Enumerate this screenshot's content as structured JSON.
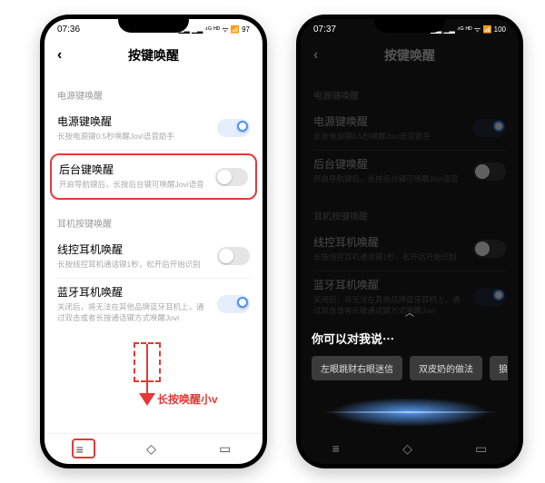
{
  "left": {
    "time": "07:36",
    "status_icons": "▁▂ ▁▂ ⁴ᴳ ᴴᴰ ᯤ 📶 97",
    "header_title": "按键唤醒",
    "section1_title": "电源键唤醒",
    "row_power": {
      "title": "电源键唤醒",
      "sub": "长按电源键0.5秒唤醒Jovi语音助手"
    },
    "row_back": {
      "title": "后台键唤醒",
      "sub": "开启导航键后，长按后台键可唤醒Jovi语音"
    },
    "section2_title": "耳机按键唤醒",
    "row_wired": {
      "title": "线控耳机唤醒",
      "sub": "长按线控耳机通话键1秒，松开后开始识别"
    },
    "row_bt": {
      "title": "蓝牙耳机唤醒",
      "sub": "关闭后，将无法在其他品牌蓝牙耳机上，通过双击或者长按通话键方式唤醒Jovi"
    },
    "annotation_label": "长按唤醒小v"
  },
  "right": {
    "time": "07:37",
    "status_icons": "▁▂ ▁▂ ⁴ᴳ ᴴᴰ ᯤ 📶 100",
    "header_title": "按键唤醒",
    "section1_title": "电源键唤醒",
    "row_power": {
      "title": "电源键唤醒",
      "sub": "长按电源键0.5秒唤醒Jovi语音助手"
    },
    "row_back": {
      "title": "后台键唤醒",
      "sub": "开启导航键后，长按后台键可唤醒Jovi语音"
    },
    "section2_title": "耳机按键唤醒",
    "row_wired": {
      "title": "线控耳机唤醒",
      "sub": "长按线控耳机通话键1秒，松开后开始识别"
    },
    "row_bt": {
      "title": "蓝牙耳机唤醒",
      "sub": "关闭后，将无法在其他品牌蓝牙耳机上，通过双击或者长按通话键方式唤醒Jovi"
    },
    "va_title": "你可以对我说⋯",
    "chips": [
      "左眼跳财右眼迷信",
      "双皮奶的做法",
      "狼人三大"
    ]
  },
  "colors": {
    "accent": "#4a90ff",
    "highlight": "#e53935"
  }
}
